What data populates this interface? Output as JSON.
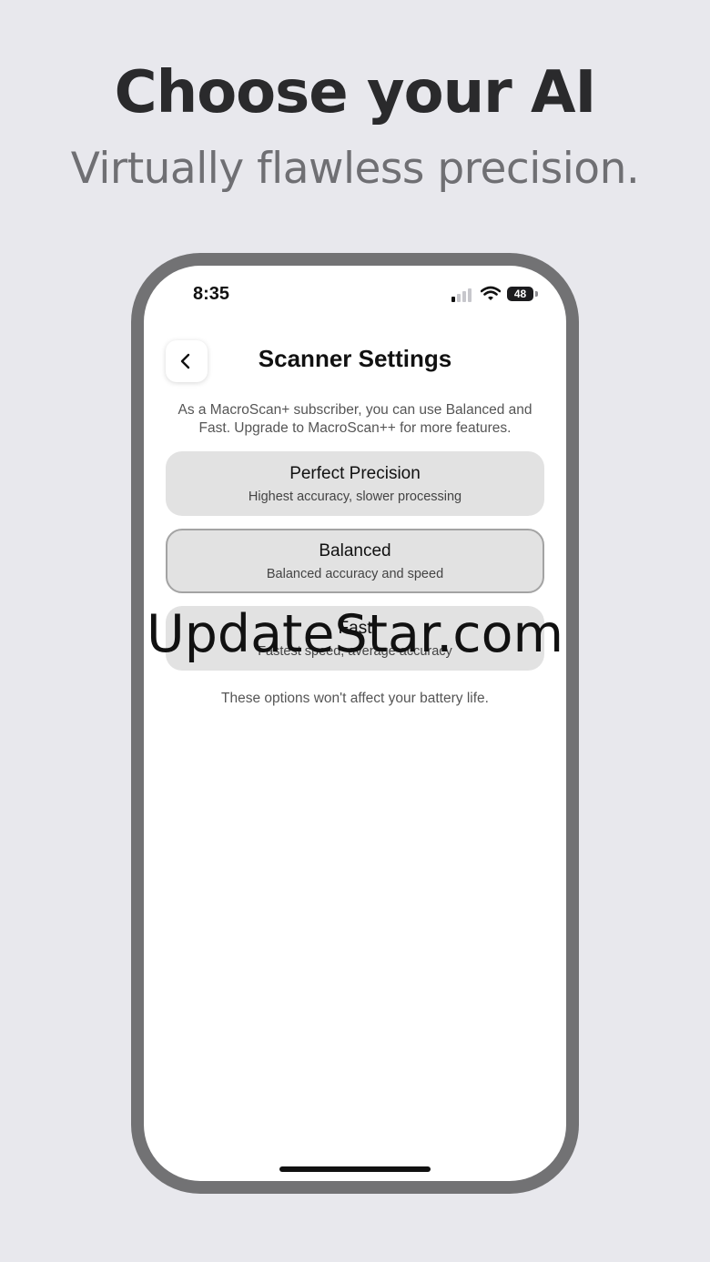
{
  "promo": {
    "headline": "Choose your AI",
    "subheadline": "Virtually flawless precision."
  },
  "status_bar": {
    "time": "8:35",
    "battery_level": "48",
    "signal_icon": "cellular-signal-icon",
    "wifi_icon": "wifi-icon"
  },
  "nav": {
    "back_icon": "chevron-left-icon",
    "title": "Scanner Settings"
  },
  "description": "As a MacroScan+ subscriber, you can use Balanced and Fast. Upgrade to MacroScan++ for more features.",
  "options": [
    {
      "title": "Perfect Precision",
      "subtitle": "Highest accuracy, slower processing",
      "selected": false
    },
    {
      "title": "Balanced",
      "subtitle": "Balanced accuracy and speed",
      "selected": true
    },
    {
      "title": "Fast",
      "subtitle": "Fastest speed, average accuracy",
      "selected": false
    }
  ],
  "footer_note": "These options won't affect your battery life.",
  "watermark": "UpdateStar.com",
  "colors": {
    "background": "#e8e8ed",
    "phone_frame": "#727274",
    "option_background": "#e2e2e2",
    "selected_border": "#a3a3a3"
  }
}
